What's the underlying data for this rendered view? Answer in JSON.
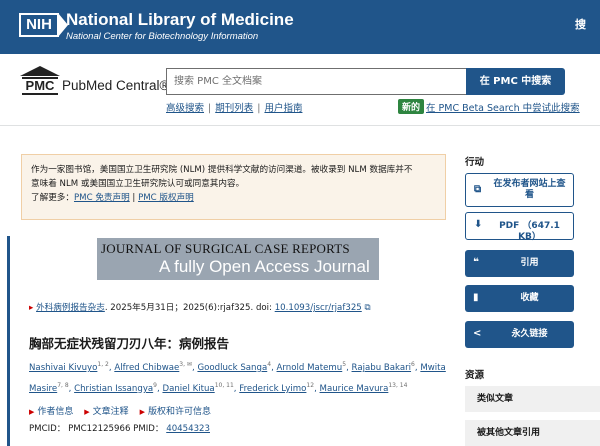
{
  "header": {
    "nih_logo": "NIH",
    "org_title": "National Library of Medicine",
    "org_subtitle": "National Center for Biotechnology Information",
    "search_label": "搜"
  },
  "pmc": {
    "logo_text": "PMC",
    "name": "PubMed Central®",
    "search_placeholder": "搜索 PMC 全文档案",
    "search_button": "在 PMC 中搜索",
    "links": [
      "高级搜索",
      "期刊列表",
      "用户指南"
    ],
    "new_badge": "新的",
    "beta_link": "在 PMC Beta Search 中尝试此搜索"
  },
  "notice": {
    "line1": "作为一家图书馆，美国国立卫生研究院 (NLM) 提供科学文献的访问渠道。被收录到 NLM 数据库并不",
    "line2": "意味着 NLM 或美国国立卫生研究院认可或同意其内容。",
    "learn_more": "了解更多：",
    "link1": "PMC 免责声明",
    "sep": " | ",
    "link2": "PMC 版权声明"
  },
  "article": {
    "journal_banner_line1": "JOURNAL OF SURGICAL CASE REPORTS",
    "journal_banner_line2": "A fully Open Access Journal",
    "citation_journal": "外科病例报告杂志",
    "citation_rest": ". 2025年5月31日；2025(6):rjaf325. doi: ",
    "doi": "10.1093/jscr/rjaf325",
    "title": "胸部无症状残留刀刃八年：病例报告",
    "authors": [
      {
        "name": "Nashivai Kivuyo",
        "sup": "1, 2"
      },
      {
        "name": "Alfred Chibwae",
        "sup": "3, ✉"
      },
      {
        "name": "Goodluck Sanga",
        "sup": "4"
      },
      {
        "name": "Arnold Matemu",
        "sup": "5"
      },
      {
        "name": "Rajabu Bakari",
        "sup": "6"
      },
      {
        "name": "Mwita Masire",
        "sup": "7, 8"
      },
      {
        "name": "Christian Issangya",
        "sup": "9"
      },
      {
        "name": "Daniel Kitua",
        "sup": "10, 11"
      },
      {
        "name": "Frederick Lyimo",
        "sup": "12"
      },
      {
        "name": "Maurice Mavura",
        "sup": "13, 14"
      }
    ],
    "info_links": [
      "作者信息",
      "文章注释",
      "版权和许可信息"
    ],
    "pmid_text": "PMCID： PMC12125966 PMID：",
    "pmid": "40454323"
  },
  "sidebar": {
    "actions_heading": "行动",
    "publisher_button": "在发布者网站上查看",
    "pdf_button": "PDF （647.1 KB）",
    "cite_button": "引用",
    "collect_button": "收藏",
    "permalink_button": "永久链接",
    "resources_heading": "资源",
    "similar_articles": "类似文章",
    "cited_by": "被其他文章引用"
  }
}
